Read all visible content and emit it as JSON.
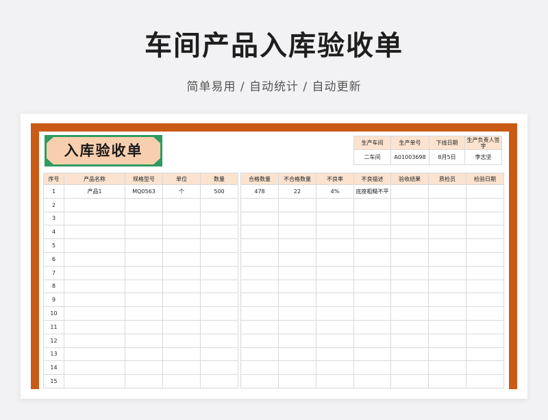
{
  "header": {
    "title": "车间产品入库验收单",
    "subtitle": "简单易用 / 自动统计 / 自动更新"
  },
  "sheet": {
    "ribbon_title": "入库验收单",
    "colors": {
      "frame": "#c95b16",
      "header_fill": "#fbe3d0",
      "ribbon_green": "#2f9b5e",
      "ribbon_fill": "#f8cfae"
    },
    "info": {
      "headers": [
        "生产车间",
        "生产单号",
        "下线日期",
        "生产负责人签字"
      ],
      "values": [
        "二车间",
        "A01003698",
        "8月5日",
        "李志坚"
      ]
    },
    "left_table": {
      "headers": [
        "序号",
        "产品名称",
        "规格型号",
        "单位",
        "数量"
      ],
      "rows": [
        [
          "1",
          "产品1",
          "MQ0563",
          "个",
          "500"
        ],
        [
          "2",
          "",
          "",
          "",
          ""
        ],
        [
          "3",
          "",
          "",
          "",
          ""
        ],
        [
          "4",
          "",
          "",
          "",
          ""
        ],
        [
          "5",
          "",
          "",
          "",
          ""
        ],
        [
          "6",
          "",
          "",
          "",
          ""
        ],
        [
          "7",
          "",
          "",
          "",
          ""
        ],
        [
          "8",
          "",
          "",
          "",
          ""
        ],
        [
          "9",
          "",
          "",
          "",
          ""
        ],
        [
          "10",
          "",
          "",
          "",
          ""
        ],
        [
          "11",
          "",
          "",
          "",
          ""
        ],
        [
          "12",
          "",
          "",
          "",
          ""
        ],
        [
          "13",
          "",
          "",
          "",
          ""
        ],
        [
          "14",
          "",
          "",
          "",
          ""
        ],
        [
          "15",
          "",
          "",
          "",
          ""
        ]
      ]
    },
    "right_table": {
      "headers": [
        "合格数量",
        "不合格数量",
        "不良率",
        "不良描述",
        "验收结果",
        "质检员",
        "检验日期"
      ],
      "rows": [
        [
          "478",
          "22",
          "4%",
          "底座粗糙不平",
          "",
          "",
          ""
        ],
        [
          "",
          "",
          "",
          "",
          "",
          "",
          ""
        ],
        [
          "",
          "",
          "",
          "",
          "",
          "",
          ""
        ],
        [
          "",
          "",
          "",
          "",
          "",
          "",
          ""
        ],
        [
          "",
          "",
          "",
          "",
          "",
          "",
          ""
        ],
        [
          "",
          "",
          "",
          "",
          "",
          "",
          ""
        ],
        [
          "",
          "",
          "",
          "",
          "",
          "",
          ""
        ],
        [
          "",
          "",
          "",
          "",
          "",
          "",
          ""
        ],
        [
          "",
          "",
          "",
          "",
          "",
          "",
          ""
        ],
        [
          "",
          "",
          "",
          "",
          "",
          "",
          ""
        ],
        [
          "",
          "",
          "",
          "",
          "",
          "",
          ""
        ],
        [
          "",
          "",
          "",
          "",
          "",
          "",
          ""
        ],
        [
          "",
          "",
          "",
          "",
          "",
          "",
          ""
        ],
        [
          "",
          "",
          "",
          "",
          "",
          "",
          ""
        ],
        [
          "",
          "",
          "",
          "",
          "",
          "",
          ""
        ]
      ]
    }
  }
}
